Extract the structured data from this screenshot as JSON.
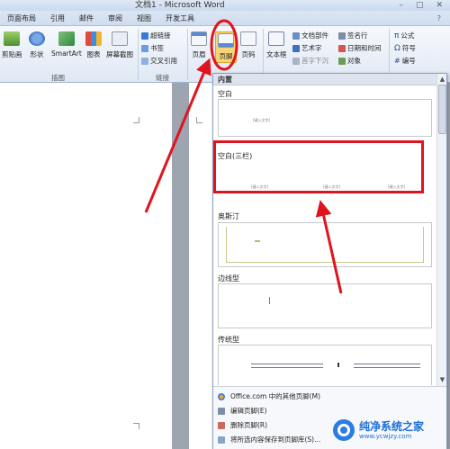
{
  "window": {
    "title": "文档1 - Microsoft Word",
    "controls": [
      "–",
      "▢",
      "✕"
    ]
  },
  "ribbon_tabs": [
    "页面布局",
    "引用",
    "邮件",
    "审阅",
    "视图",
    "开发工具"
  ],
  "help_icon": "?",
  "ribbon": {
    "illustrations": {
      "buttons": [
        "剪贴画",
        "形状",
        "SmartArt",
        "图表",
        "屏幕截图"
      ],
      "group_label": "插图"
    },
    "links": {
      "items": [
        "超链接",
        "书签",
        "交叉引用"
      ],
      "group_label": "链接"
    },
    "header_footer": {
      "header": "页眉",
      "footer": "页脚",
      "page_number": "页码"
    },
    "text": {
      "textbox": "文本框",
      "items": [
        "文档部件",
        "艺术字",
        "首字下沉",
        "签名行",
        "日期和时间",
        "对象"
      ]
    },
    "symbols": {
      "items": [
        "公式",
        "符号",
        "编号"
      ]
    }
  },
  "gallery": {
    "section": "内置",
    "items": [
      {
        "title": "空白",
        "placeholders": [
          "[键入文字]"
        ]
      },
      {
        "title": "空白(三栏)",
        "placeholders": [
          "[键入文字]",
          "[键入文字]",
          "[键入文字]"
        ]
      },
      {
        "title": "奥斯汀",
        "placeholders": []
      },
      {
        "title": "边线型",
        "placeholders": []
      },
      {
        "title": "传统型",
        "placeholders": []
      }
    ],
    "footer": [
      {
        "label": "Office.com 中的其他页脚(M)",
        "icon": "office-icon"
      },
      {
        "label": "编辑页脚(E)",
        "icon": "edit-footer-icon"
      },
      {
        "label": "删除页脚(R)",
        "icon": "delete-footer-icon"
      },
      {
        "label": "将所选内容保存到页脚库(S)...",
        "icon": "save-to-gallery-icon"
      }
    ]
  },
  "watermark": {
    "main": "纯净系统之家",
    "sub": "www.ycwjzy.com"
  },
  "colors": {
    "annotation": "#e0141e",
    "ribbon_bg": "#dfe8f4",
    "highlight_footer": "#f5c542"
  }
}
